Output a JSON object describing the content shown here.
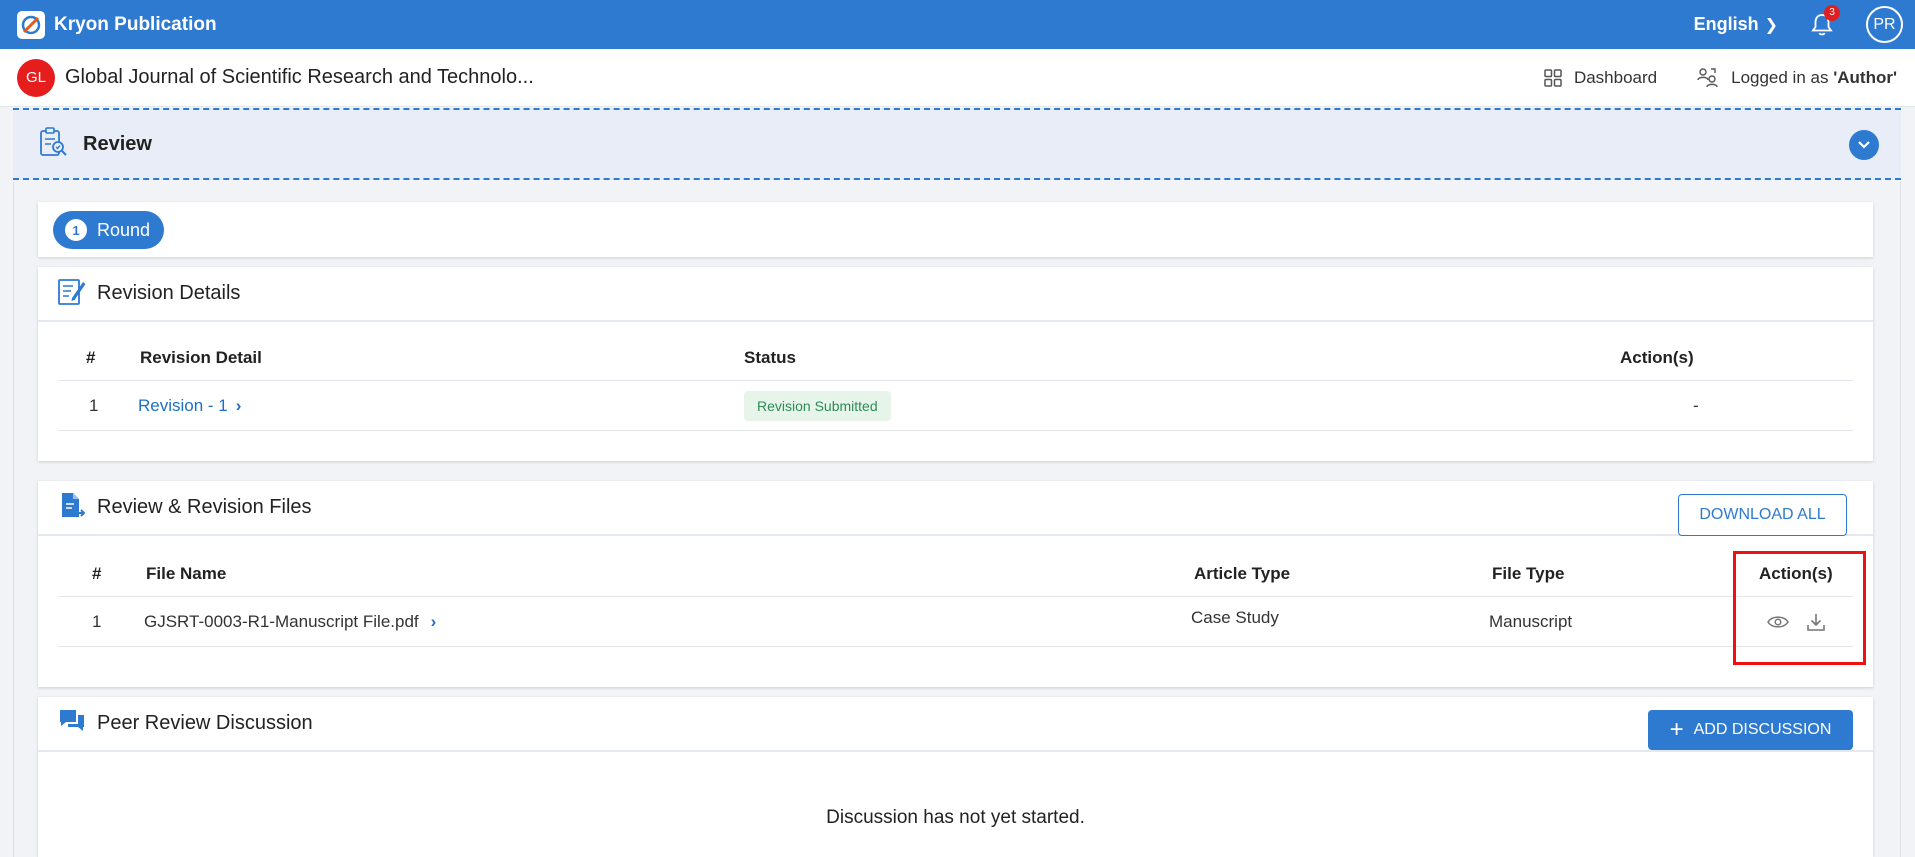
{
  "topbar": {
    "brand": "Kryon Publication",
    "language": "English",
    "notification_count": "3",
    "avatar_initials": "PR",
    "bg_color": "#2e7ad1"
  },
  "subheader": {
    "journal_initials": "GL",
    "journal_title": "Global Journal of Scientific Research and Technolo...",
    "dashboard_label": "Dashboard",
    "logged_in_prefix": "Logged in as ",
    "logged_in_role": "'Author'"
  },
  "review": {
    "title": "Review"
  },
  "round": {
    "number": "1",
    "label": "Round"
  },
  "revision_details": {
    "title": "Revision Details",
    "columns": [
      "#",
      "Revision Detail",
      "Status",
      "Action(s)"
    ],
    "rows": [
      {
        "index": "1",
        "detail": "Revision - 1",
        "status": "Revision Submitted",
        "action": "-"
      }
    ]
  },
  "files": {
    "title": "Review & Revision Files",
    "download_all": "DOWNLOAD ALL",
    "columns": [
      "#",
      "File Name",
      "Article Type",
      "File Type",
      "Action(s)"
    ],
    "rows": [
      {
        "index": "1",
        "file_name": "GJSRT-0003-R1-Manuscript File.pdf",
        "article_type": "Case Study",
        "file_type": "Manuscript",
        "actions": [
          "eye-icon",
          "download-icon"
        ]
      }
    ]
  },
  "discussion": {
    "title": "Peer Review Discussion",
    "add_button": "ADD DISCUSSION",
    "empty_message": "Discussion has not yet started."
  }
}
